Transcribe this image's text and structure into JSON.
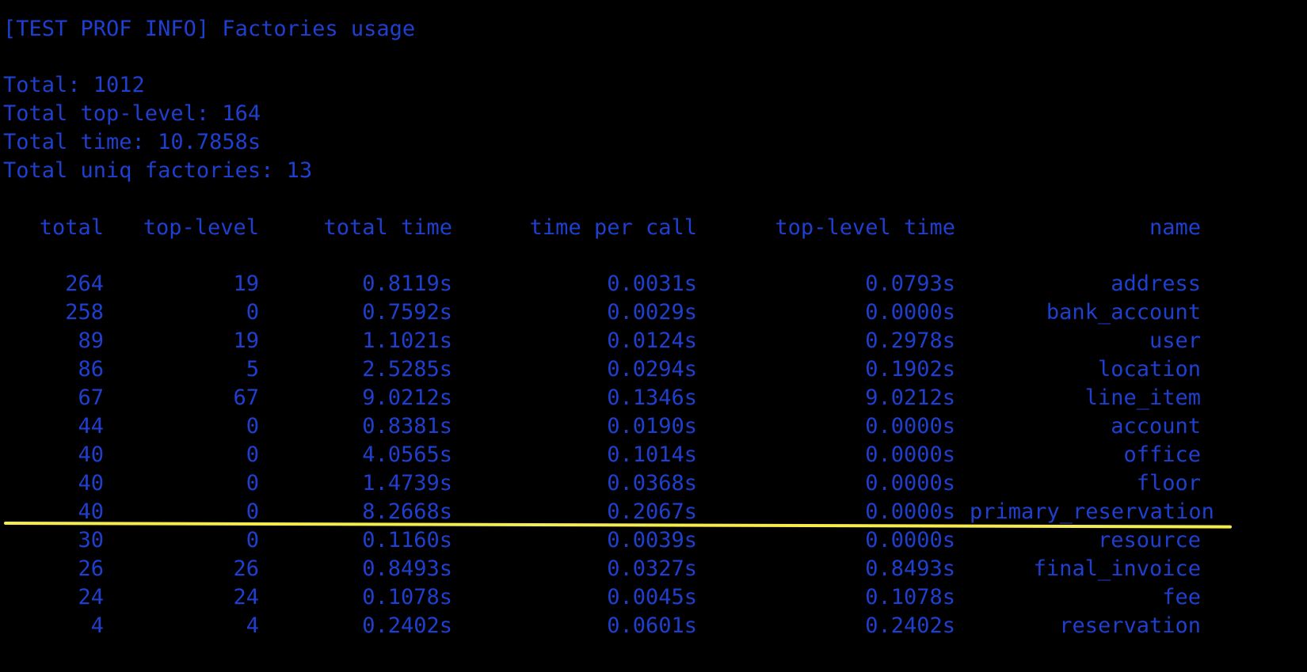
{
  "title": "[TEST PROF INFO] Factories usage",
  "summary": {
    "total": "Total: 1012",
    "total_top_level": "Total top-level: 164",
    "total_time": "Total time: 10.7858s",
    "total_uniq": "Total uniq factories: 13"
  },
  "columns": [
    "total",
    "top-level",
    "total time",
    "time per call",
    "top-level time",
    "name"
  ],
  "rows": [
    [
      "264",
      "19",
      "0.8119s",
      "0.0031s",
      "0.0793s",
      "address"
    ],
    [
      "258",
      "0",
      "0.7592s",
      "0.0029s",
      "0.0000s",
      "bank_account"
    ],
    [
      "89",
      "19",
      "1.1021s",
      "0.0124s",
      "0.2978s",
      "user"
    ],
    [
      "86",
      "5",
      "2.5285s",
      "0.0294s",
      "0.1902s",
      "location"
    ],
    [
      "67",
      "67",
      "9.0212s",
      "0.1346s",
      "9.0212s",
      "line_item"
    ],
    [
      "44",
      "0",
      "0.8381s",
      "0.0190s",
      "0.0000s",
      "account"
    ],
    [
      "40",
      "0",
      "4.0565s",
      "0.1014s",
      "0.0000s",
      "office"
    ],
    [
      "40",
      "0",
      "1.4739s",
      "0.0368s",
      "0.0000s",
      "floor"
    ],
    [
      "40",
      "0",
      "8.2668s",
      "0.2067s",
      "0.0000s",
      "primary_reservation"
    ],
    [
      "30",
      "0",
      "0.1160s",
      "0.0039s",
      "0.0000s",
      "resource"
    ],
    [
      "26",
      "26",
      "0.8493s",
      "0.0327s",
      "0.8493s",
      "final_invoice"
    ],
    [
      "24",
      "24",
      "0.1078s",
      "0.0045s",
      "0.1078s",
      "fee"
    ],
    [
      "4",
      "4",
      "0.2402s",
      "0.0601s",
      "0.2402s",
      "reservation"
    ]
  ],
  "colors": {
    "text": "#1f3fd0",
    "background": "#000000",
    "highlight": "#f4ec4c"
  }
}
